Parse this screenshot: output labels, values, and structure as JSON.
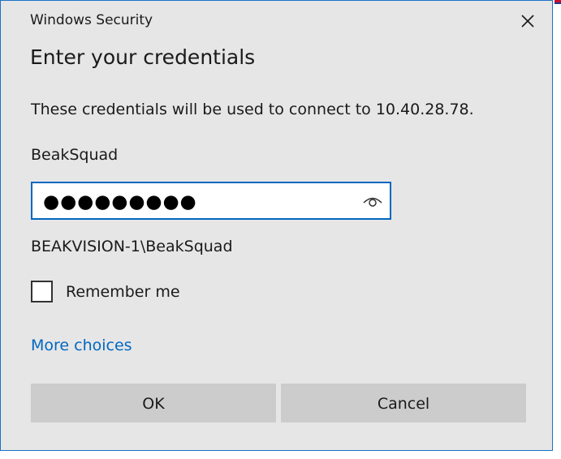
{
  "window": {
    "title": "Windows Security",
    "close_icon": "close-icon"
  },
  "dialog": {
    "heading": "Enter your credentials",
    "description": "These credentials will be used to connect to 10.40.28.78.",
    "username": "BeakSquad",
    "password_masked": "●●●●●●●●●",
    "reveal_icon": "eye-icon",
    "domain_user": "BEAKVISION-1\\BeakSquad",
    "remember_label": "Remember me",
    "remember_checked": false,
    "more_choices": "More choices"
  },
  "buttons": {
    "ok": "OK",
    "cancel": "Cancel"
  },
  "colors": {
    "accent": "#0067c0",
    "dialog_bg": "#e6e6e6",
    "button_bg": "#cccccc"
  }
}
